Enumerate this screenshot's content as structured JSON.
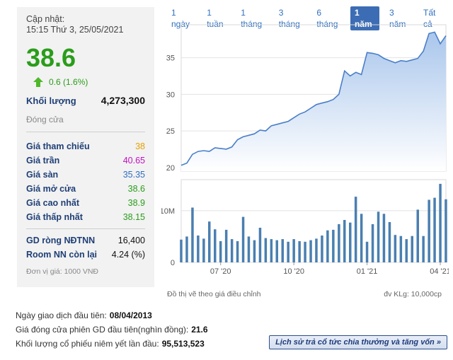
{
  "quote": {
    "updated_label": "Cập nhật:",
    "updated_time": "15:15 Thứ 3, 25/05/2021",
    "price": "38.6",
    "change": "0.6 (1.6%)",
    "volume_label": "Khối lượng",
    "volume_value": "4,273,300",
    "status": "Đóng cửa",
    "stats": [
      {
        "label": "Giá tham chiếu",
        "value": "38",
        "color": "#e8a000"
      },
      {
        "label": "Giá trần",
        "value": "40.65",
        "color": "#c010c0"
      },
      {
        "label": "Giá sàn",
        "value": "35.35",
        "color": "#2f6fbf"
      },
      {
        "label": "Giá mở cửa",
        "value": "38.6",
        "color": "#2a9d1a"
      },
      {
        "label": "Giá cao nhất",
        "value": "38.9",
        "color": "#2a9d1a"
      },
      {
        "label": "Giá thấp nhất",
        "value": "38.15",
        "color": "#2a9d1a"
      }
    ],
    "foreign": [
      {
        "label": "GD ròng NĐTNN",
        "value": "16,400"
      },
      {
        "label": "Room NN còn lại",
        "value": "4.24 (%)"
      }
    ],
    "unit_note": "Đơn vị giá: 1000 VNĐ"
  },
  "tabs": [
    {
      "label": "1 ngày",
      "active": false
    },
    {
      "label": "1 tuần",
      "active": false
    },
    {
      "label": "1 tháng",
      "active": false
    },
    {
      "label": "3 tháng",
      "active": false
    },
    {
      "label": "6 tháng",
      "active": false
    },
    {
      "label": "1 năm",
      "active": true
    },
    {
      "label": "3 năm",
      "active": false
    },
    {
      "label": "Tất cả",
      "active": false
    }
  ],
  "chart_data": {
    "type": "area",
    "price_axis": {
      "ticks": [
        20,
        25,
        30,
        35
      ],
      "ylim": [
        19.5,
        39.5
      ]
    },
    "volume_axis": {
      "ticks": [
        "0",
        "10M"
      ],
      "tick_values": [
        0,
        10
      ],
      "ylim": [
        0,
        16
      ]
    },
    "x_ticks": [
      "07 '20",
      "10 '20",
      "01 '21",
      "04 '21"
    ],
    "x_tick_index": [
      7,
      20,
      33,
      46
    ],
    "price": [
      20.3,
      20.6,
      21.8,
      22.2,
      22.3,
      22.2,
      22.7,
      22.6,
      22.5,
      22.8,
      23.8,
      24.2,
      24.4,
      24.6,
      25.1,
      25.0,
      25.7,
      25.9,
      26.1,
      26.3,
      26.8,
      27.3,
      27.6,
      28.1,
      28.6,
      28.8,
      29.0,
      29.3,
      30.0,
      33.2,
      32.5,
      33.0,
      32.7,
      35.7,
      35.6,
      35.4,
      34.9,
      34.6,
      34.3,
      34.6,
      34.5,
      34.7,
      34.9,
      35.9,
      38.3,
      38.5,
      36.9,
      38.0
    ],
    "volume": [
      4.4,
      5.0,
      10.6,
      5.2,
      4.6,
      7.9,
      6.4,
      4.1,
      6.3,
      4.5,
      4.1,
      8.8,
      5.0,
      4.3,
      6.7,
      4.7,
      4.5,
      4.3,
      4.5,
      4.0,
      4.5,
      4.1,
      4.0,
      4.3,
      4.6,
      5.2,
      6.2,
      6.3,
      7.4,
      8.2,
      7.7,
      12.7,
      9.4,
      4.0,
      7.4,
      9.8,
      9.4,
      7.8,
      5.3,
      5.1,
      4.5,
      5.1,
      10.2,
      5.1,
      12.1,
      12.5,
      15.2,
      12.2
    ]
  },
  "chart_note": "Đồ thị vẽ theo giá điều chỉnh",
  "chart_unit": "đv KLg: 10,000cp",
  "info": [
    {
      "label": "Ngày giao dịch đầu tiên:",
      "value": "08/04/2013"
    },
    {
      "label": "Giá đóng cửa phiên GD đầu tiên(nghìn đồng):",
      "value": "21.6"
    },
    {
      "label": "Khối lượng cổ phiếu niêm yết lần đầu:",
      "value": "95,513,523"
    }
  ],
  "history_link": "Lịch sử trả cổ tức chia thưởng và tăng vốn »",
  "colors": {
    "accent": "#3c6db4",
    "up": "#2a9d1a",
    "line": "#4a7fc8",
    "bar": "#4a7fb0"
  }
}
